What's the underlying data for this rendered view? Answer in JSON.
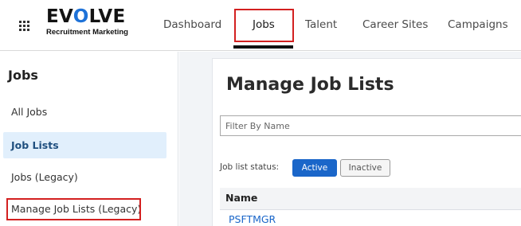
{
  "brand": {
    "name_prefix": "EV",
    "name_o": "O",
    "name_suffix": "LVE",
    "tagline": "Recruitment Marketing",
    "accent_color": "#1e72d8"
  },
  "nav": {
    "menu_icon": "apps-grid-icon",
    "items": [
      {
        "label": "Dashboard"
      },
      {
        "label": "Jobs",
        "active": true
      },
      {
        "label": "Talent"
      },
      {
        "label": "Career Sites"
      },
      {
        "label": "Campaigns"
      }
    ]
  },
  "sidebar": {
    "title": "Jobs",
    "items": [
      {
        "label": "All Jobs"
      },
      {
        "label": "Job Lists",
        "active": true
      },
      {
        "label": "Jobs (Legacy)"
      },
      {
        "label": "Manage Job Lists (Legacy)"
      }
    ]
  },
  "main": {
    "title": "Manage Job Lists",
    "filter": {
      "placeholder": "Filter By Name",
      "value": ""
    },
    "status": {
      "label": "Job list status:",
      "active_label": "Active",
      "inactive_label": "Inactive",
      "selected": "Active"
    },
    "table": {
      "columns": [
        "Name"
      ],
      "rows": [
        {
          "name": "PSFTMGR"
        }
      ]
    }
  },
  "colors": {
    "primary_button": "#1a66c9",
    "highlight_box": "#d32020",
    "active_sidebar_bg": "#e1effc"
  }
}
